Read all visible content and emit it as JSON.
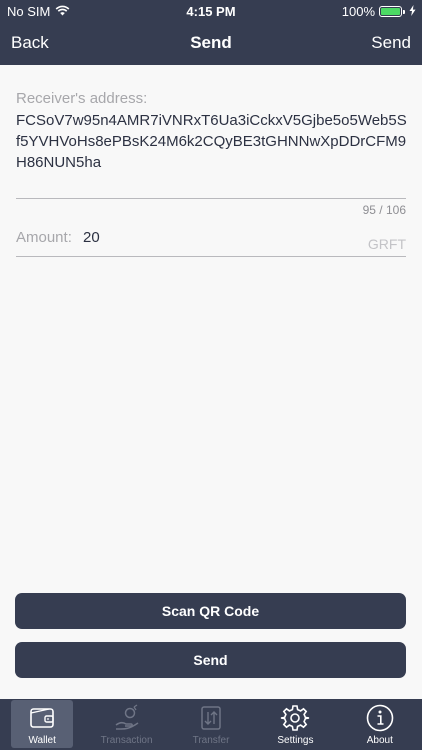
{
  "status": {
    "carrier": "No SIM",
    "time": "4:15 PM",
    "battery": "100%",
    "battery_level": 1.0
  },
  "nav": {
    "back": "Back",
    "title": "Send",
    "action": "Send"
  },
  "form": {
    "address_label": "Receiver's address:",
    "address_value": "FCSoV7w95n4AMR7iVNRxT6Ua3iCckxV5Gjbe5o5Web5Sf5YVHVoHs8ePBsK24M6k2CQyBE3tGHNNwXpDDrCFM9H86NUN5ha",
    "address_counter": "95 / 106",
    "amount_label": "Amount:",
    "amount_value": "20",
    "amount_unit": "GRFT"
  },
  "buttons": {
    "scan_qr": "Scan QR Code",
    "send": "Send"
  },
  "tabs": [
    {
      "label": "Wallet",
      "icon": "wallet-icon",
      "active": true,
      "disabled": false
    },
    {
      "label": "Transaction",
      "icon": "transaction-icon",
      "active": false,
      "disabled": true
    },
    {
      "label": "Transfer",
      "icon": "transfer-icon",
      "active": false,
      "disabled": true
    },
    {
      "label": "Settings",
      "icon": "gear-icon",
      "active": false,
      "disabled": false
    },
    {
      "label": "About",
      "icon": "info-icon",
      "active": false,
      "disabled": false
    }
  ],
  "colors": {
    "bar_background": "#363d51",
    "page_background": "#f8f8f8",
    "battery_fill": "#4cd964",
    "active_tab": "#586074"
  }
}
